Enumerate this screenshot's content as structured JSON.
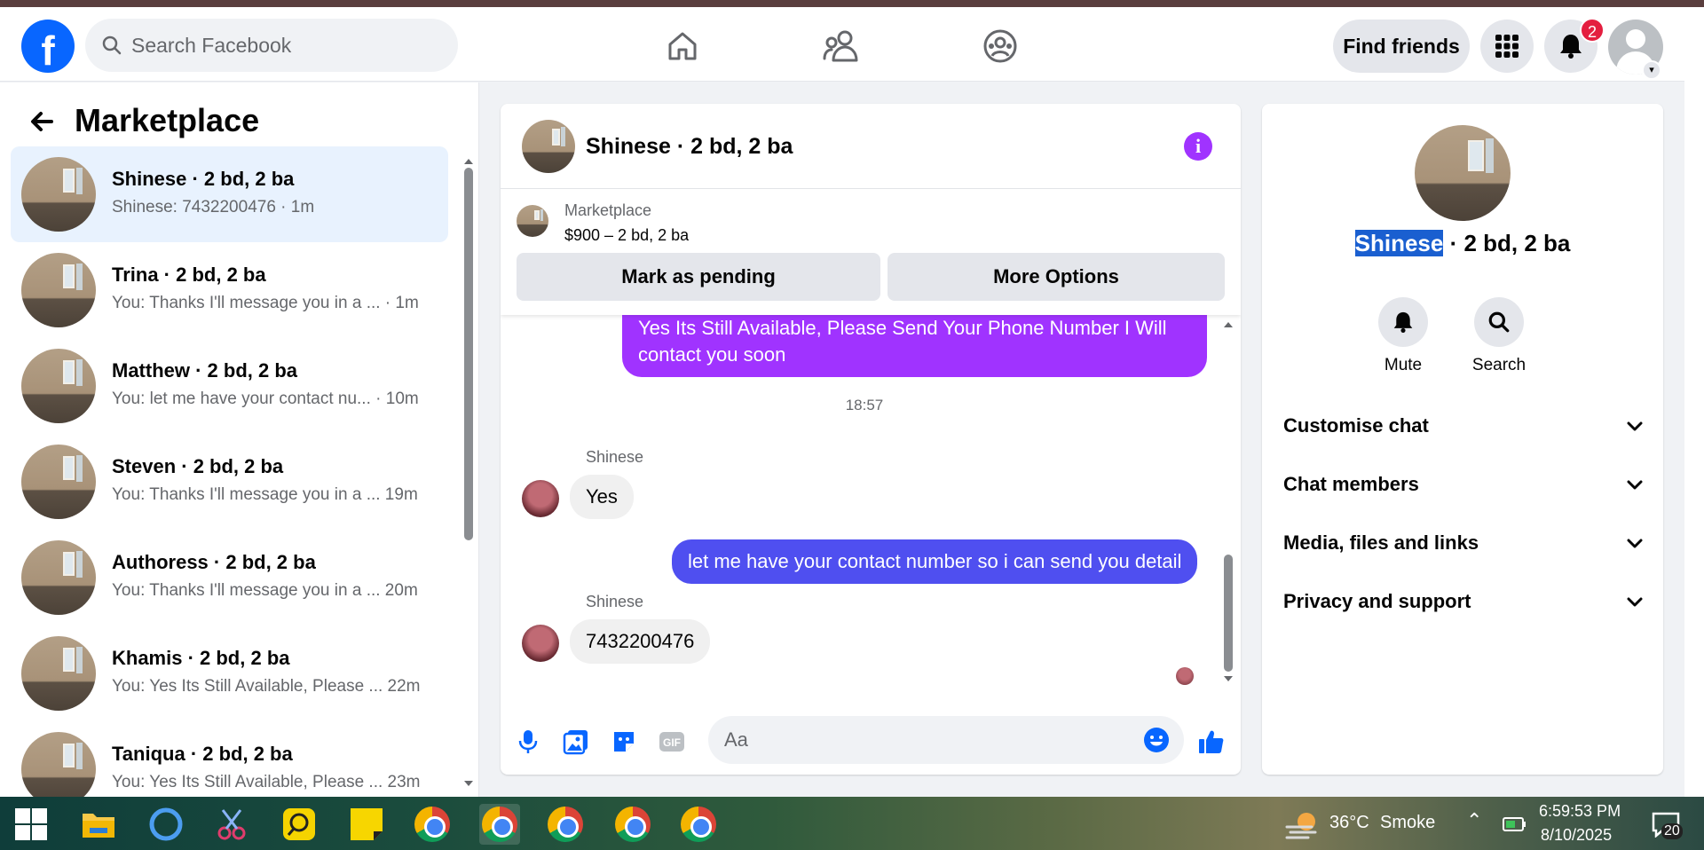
{
  "header": {
    "logo": "f",
    "search_placeholder": "Search Facebook",
    "find_friends": "Find friends",
    "notification_count": "2"
  },
  "left": {
    "title": "Marketplace",
    "conversations": [
      {
        "name": "Shinese · 2 bd, 2 ba",
        "preview": "Shinese: 7432200476 · 1m",
        "active": true
      },
      {
        "name": "Trina · 2 bd, 2 ba",
        "preview": "You: Thanks I'll message you in a ...  · 1m"
      },
      {
        "name": "Matthew · 2 bd, 2 ba",
        "preview": "You: let me have your contact nu...  · 10m"
      },
      {
        "name": "Steven · 2 bd, 2 ba",
        "preview": "You: Thanks I'll message you in a ... 19m"
      },
      {
        "name": "Authoress · 2 bd, 2 ba",
        "preview": "You: Thanks I'll message you in a ... 20m"
      },
      {
        "name": "Khamis · 2 bd, 2 ba",
        "preview": "You: Yes Its Still Available, Please ...  22m"
      },
      {
        "name": "Taniqua · 2 bd, 2 ba",
        "preview": "You: Yes Its Still Available, Please ...  23m"
      }
    ]
  },
  "chat": {
    "title": "Shinese · 2 bd, 2 ba",
    "marketplace_label": "Marketplace",
    "listing": "$900 – 2 bd, 2 ba",
    "mark_pending": "Mark as pending",
    "more_options": "More Options",
    "messages": {
      "out1": "Yes Its Still Available, Please Send Your Phone Number I Will contact you soon",
      "time": "18:57",
      "sender1": "Shinese",
      "in1": "Yes",
      "out2": "let me have your contact number so i can send you detail",
      "sender2": "Shinese",
      "in2": "7432200476"
    },
    "composer_placeholder": "Aa",
    "colors": {
      "outgoing_purple": "#a033ff",
      "outgoing_blue": "#4f4ff0",
      "accent": "#a033ff"
    }
  },
  "right": {
    "title_highlight": "Shinese",
    "title_rest": " · 2 bd, 2 ba",
    "mute": "Mute",
    "search": "Search",
    "sections": [
      "Customise chat",
      "Chat members",
      "Media, files and links",
      "Privacy and support"
    ]
  },
  "taskbar": {
    "weather_temp": "36°C",
    "weather_desc": "Smoke",
    "time": "6:59:53 PM",
    "date": "8/10/2025",
    "notif_count": "20"
  }
}
